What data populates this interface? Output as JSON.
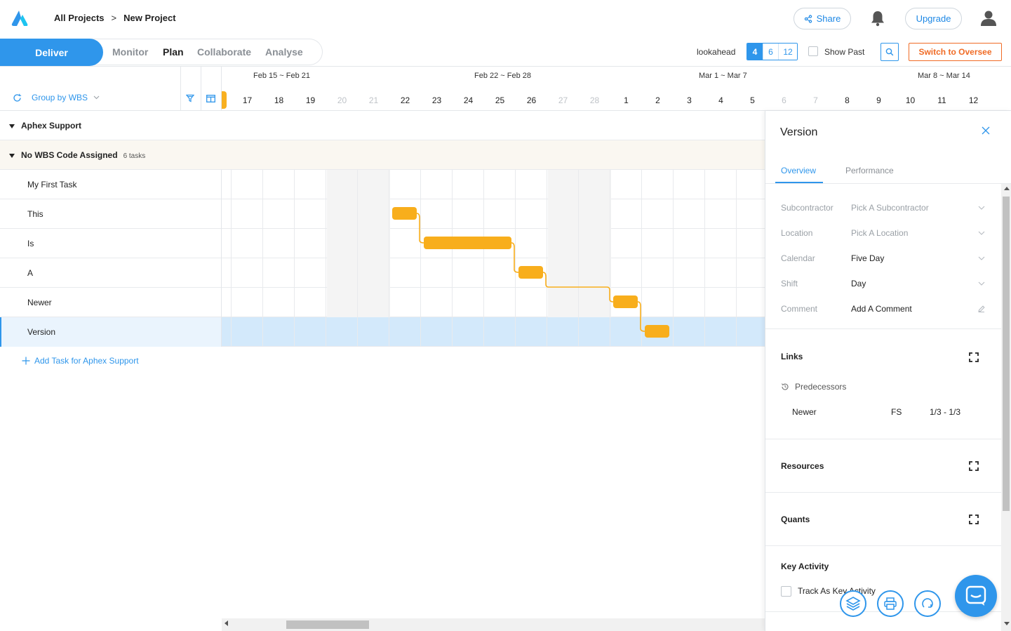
{
  "header": {
    "breadcrumb": [
      "All Projects",
      "New Project"
    ],
    "breadcrumb_sep": ">",
    "share_label": "Share",
    "upgrade_label": "Upgrade"
  },
  "nav": {
    "items": [
      "Deliver",
      "Monitor",
      "Plan",
      "Collaborate",
      "Analyse"
    ],
    "active": "Plan"
  },
  "toolbar": {
    "lookahead_label": "lookahead",
    "lookahead_options": [
      "4",
      "6",
      "12"
    ],
    "lookahead_selected": "4",
    "show_past_label": "Show Past",
    "show_past_checked": false,
    "switch_label": "Switch to Oversee"
  },
  "grid": {
    "group_by_label": "Group by WBS",
    "weeks": [
      "Feb 15 ~ Feb 21",
      "Feb 22 ~ Feb 28",
      "Mar 1 ~ Mar 7",
      "Mar 8 ~ Mar 14"
    ],
    "days": [
      {
        "d": "17",
        "weekend": false
      },
      {
        "d": "18",
        "weekend": false
      },
      {
        "d": "19",
        "weekend": false
      },
      {
        "d": "20",
        "weekend": true
      },
      {
        "d": "21",
        "weekend": true
      },
      {
        "d": "22",
        "weekend": false
      },
      {
        "d": "23",
        "weekend": false
      },
      {
        "d": "24",
        "weekend": false
      },
      {
        "d": "25",
        "weekend": false
      },
      {
        "d": "26",
        "weekend": false
      },
      {
        "d": "27",
        "weekend": true
      },
      {
        "d": "28",
        "weekend": true
      },
      {
        "d": "1",
        "weekend": false
      },
      {
        "d": "2",
        "weekend": false
      },
      {
        "d": "3",
        "weekend": false
      },
      {
        "d": "4",
        "weekend": false
      },
      {
        "d": "5",
        "weekend": false
      },
      {
        "d": "6",
        "weekend": true
      },
      {
        "d": "7",
        "weekend": true
      },
      {
        "d": "8",
        "weekend": false
      },
      {
        "d": "9",
        "weekend": false
      },
      {
        "d": "10",
        "weekend": false
      },
      {
        "d": "11",
        "weekend": false
      },
      {
        "d": "12",
        "weekend": false
      }
    ],
    "project": "Aphex Support",
    "wbs_group": "No WBS Code Assigned",
    "wbs_count": "6 tasks",
    "tasks": [
      {
        "name": "My First Task"
      },
      {
        "name": "This",
        "start": "22",
        "end": "22"
      },
      {
        "name": "Is",
        "start": "23",
        "end": "25"
      },
      {
        "name": "A",
        "start": "26",
        "end": "26"
      },
      {
        "name": "Newer",
        "start": "1",
        "end": "1"
      },
      {
        "name": "Version",
        "start": "2",
        "end": "2"
      }
    ],
    "selected_task": "Version",
    "add_task_label": "Add Task for Aphex Support"
  },
  "panel": {
    "title": "Version",
    "tabs": [
      "Overview",
      "Performance"
    ],
    "active_tab": "Overview",
    "fields": [
      {
        "label": "Subcontractor",
        "value": "Pick A Subcontractor",
        "placeholder": true,
        "icon": "chevron-down-icon"
      },
      {
        "label": "Location",
        "value": "Pick A Location",
        "placeholder": true,
        "icon": "chevron-down-icon"
      },
      {
        "label": "Calendar",
        "value": "Five Day",
        "placeholder": false,
        "icon": "chevron-down-icon"
      },
      {
        "label": "Shift",
        "value": "Day",
        "placeholder": false,
        "icon": "chevron-down-icon"
      },
      {
        "label": "Comment",
        "value": "Add A Comment",
        "placeholder": false,
        "icon": "pencil-icon"
      }
    ],
    "links_title": "Links",
    "predecessors_label": "Predecessors",
    "predecessor": {
      "task": "Newer",
      "type": "FS",
      "range": "1/3 - 1/3"
    },
    "resources_title": "Resources",
    "quants_title": "Quants",
    "key_activity_title": "Key Activity",
    "track_key_label": "Track As Key Activity"
  },
  "colors": {
    "accent": "#2f96eb",
    "bar": "#f8ae1c",
    "oversee": "#f06b25",
    "selected_row": "#d3e9fb"
  }
}
